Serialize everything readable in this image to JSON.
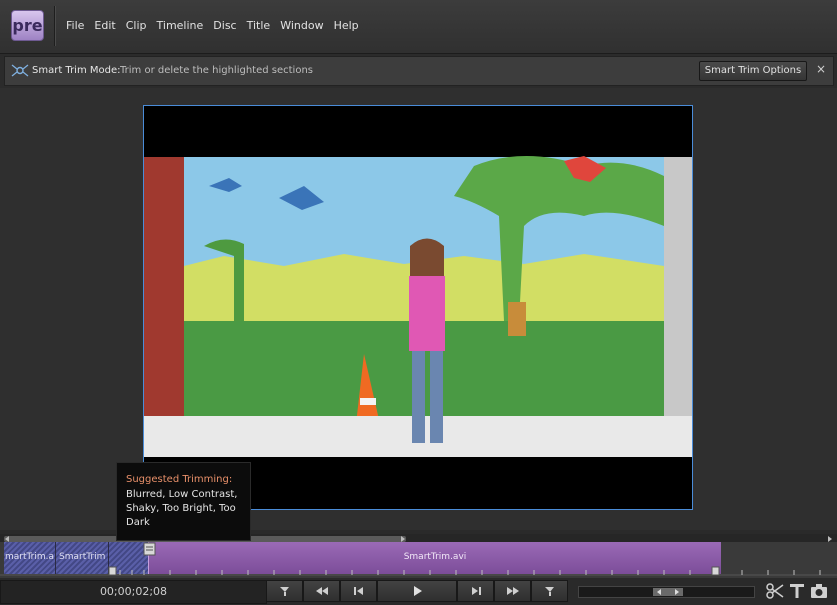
{
  "app": {
    "logo_text": "pre"
  },
  "menu": [
    "File",
    "Edit",
    "Clip",
    "Timeline",
    "Disc",
    "Title",
    "Window",
    "Help"
  ],
  "mode_bar": {
    "title": "Smart Trim Mode",
    "separator": ":",
    "description": "Trim or delete the highlighted sections",
    "options_button": "Smart Trim Options",
    "close_label": "×"
  },
  "tooltip": {
    "title": "Suggested Trimming:",
    "body": "Blurred, Low Contrast, Shaky, Too Bright, Too Dark"
  },
  "timeline": {
    "clips": [
      {
        "label": "martTrim.a"
      },
      {
        "label": "SmartTrim"
      },
      {
        "label": "SmartTrim.avi"
      }
    ]
  },
  "controls": {
    "timecode": "00;00;02;08"
  },
  "colors": {
    "accent_blue": "#4a8cd8",
    "clip_purple": "#8a5aa8",
    "tooltip_title": "#e8906a"
  }
}
